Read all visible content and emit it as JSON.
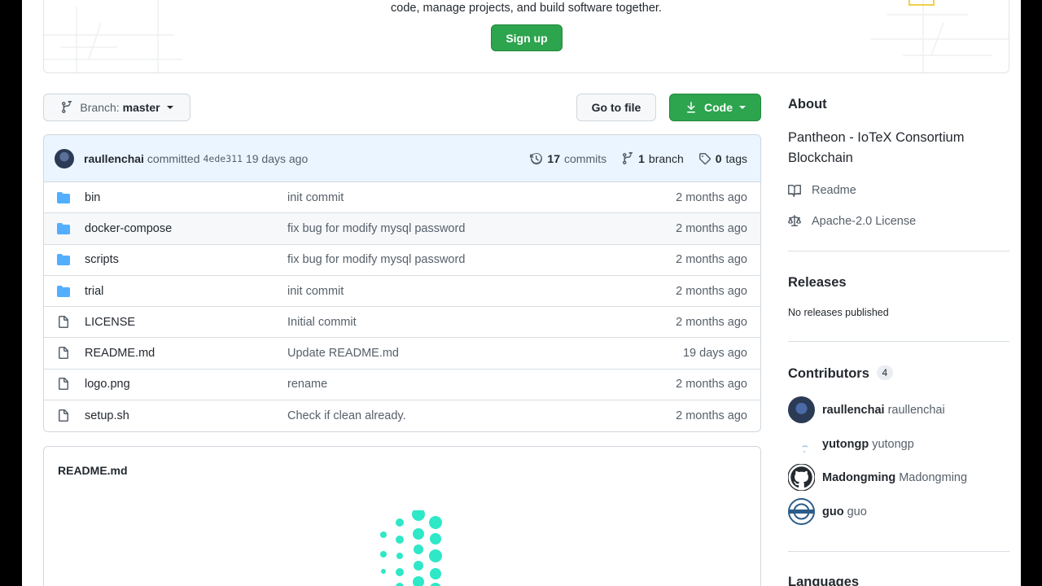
{
  "hero": {
    "text": "code, manage projects, and build software together.",
    "signup_label": "Sign up"
  },
  "toolbar": {
    "branch_label": "Branch:",
    "branch_value": "master",
    "goto_file_label": "Go to file",
    "code_label": "Code"
  },
  "commit": {
    "author": "raullenchai",
    "verb": "committed",
    "sha": "4ede311",
    "when": "19 days ago",
    "commits_count": "17",
    "commits_label": "commits",
    "branch_count": "1",
    "branch_label": "branch",
    "tags_count": "0",
    "tags_label": "tags"
  },
  "files": [
    {
      "type": "folder",
      "name": "bin",
      "message": "init commit",
      "age": "2 months ago"
    },
    {
      "type": "folder",
      "name": "docker-compose",
      "message": "fix bug for modify mysql password",
      "age": "2 months ago"
    },
    {
      "type": "folder",
      "name": "scripts",
      "message": "fix bug for modify mysql password",
      "age": "2 months ago"
    },
    {
      "type": "folder",
      "name": "trial",
      "message": "init commit",
      "age": "2 months ago"
    },
    {
      "type": "file",
      "name": "LICENSE",
      "message": "Initial commit",
      "age": "2 months ago"
    },
    {
      "type": "file",
      "name": "README.md",
      "message": "Update README.md",
      "age": "19 days ago"
    },
    {
      "type": "file",
      "name": "logo.png",
      "message": "rename",
      "age": "2 months ago"
    },
    {
      "type": "file",
      "name": "setup.sh",
      "message": "Check if clean already.",
      "age": "2 months ago"
    }
  ],
  "readme": {
    "title": "README.md"
  },
  "sidebar": {
    "about_heading": "About",
    "about_desc": "Pantheon - IoTeX Consortium Blockchain",
    "readme_link": "Readme",
    "license_link": "Apache-2.0 License",
    "releases_heading": "Releases",
    "releases_note": "No releases published",
    "contributors_heading": "Contributors",
    "contributors_count": "4",
    "contributors": [
      {
        "name": "raullenchai",
        "login": "raullenchai"
      },
      {
        "name": "yutongp",
        "login": "yutongp"
      },
      {
        "name": "Madongming",
        "login": "Madongming"
      },
      {
        "name": "guo",
        "login": "guo"
      }
    ],
    "languages_heading": "Languages"
  },
  "colors": {
    "green": "#2da44e",
    "folder": "#54aeff",
    "logo_teal": "#2ee8c7"
  }
}
